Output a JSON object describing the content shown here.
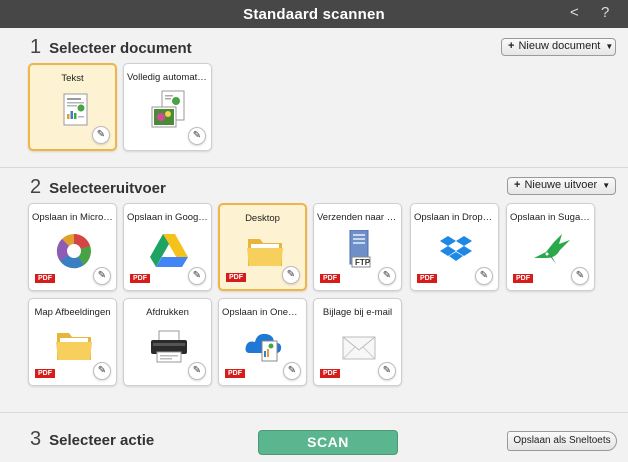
{
  "window": {
    "title": "Standaard scannen",
    "back_glyph": "<",
    "help_glyph": "?"
  },
  "select_document": {
    "number": "1",
    "title": "Selecteer document",
    "new_button": "Nieuw document",
    "items": [
      {
        "label": "Tekst",
        "icon": "text-document-icon",
        "selected": true
      },
      {
        "label": "Volledig automatis...",
        "icon": "auto-documents-icon",
        "selected": false
      }
    ]
  },
  "select_output": {
    "number": "2",
    "title": "Selecteeruitvoer",
    "new_button": "Nieuwe uitvoer",
    "pdf_badge": "PDF",
    "items": [
      {
        "label": "Opslaan in Micros...",
        "icon": "microsoft-onenote-icon",
        "pdf": true
      },
      {
        "label": "Opslaan in Google...",
        "icon": "google-drive-icon",
        "pdf": true
      },
      {
        "label": "Desktop",
        "icon": "desktop-folder-icon",
        "pdf": true,
        "selected": true
      },
      {
        "label": "Verzenden naar FT...",
        "icon": "ftp-server-icon",
        "pdf": true,
        "ftp_text": "FTP"
      },
      {
        "label": "Opslaan in Dropbox",
        "icon": "dropbox-icon",
        "pdf": true
      },
      {
        "label": "Opslaan in SugarS...",
        "icon": "sugarsync-hummingbird-icon",
        "pdf": true
      },
      {
        "label": "Map Afbeeldingen",
        "icon": "pictures-folder-icon",
        "pdf": true
      },
      {
        "label": "Afdrukken",
        "icon": "printer-icon",
        "pdf": false
      },
      {
        "label": "Opslaan in OneDri...",
        "icon": "onedrive-icon",
        "pdf": true
      },
      {
        "label": "Bijlage bij e-mail",
        "icon": "email-envelope-icon",
        "pdf": true
      }
    ]
  },
  "select_action": {
    "number": "3",
    "title": "Selecteer actie",
    "scan_button": "SCAN",
    "shortcut_button": "Opslaan als Sneltoets"
  },
  "colors": {
    "titlebar": "#474747",
    "scan": "#5bb58e",
    "selected_border": "#f0b549",
    "pdf": "#d71c1c"
  }
}
